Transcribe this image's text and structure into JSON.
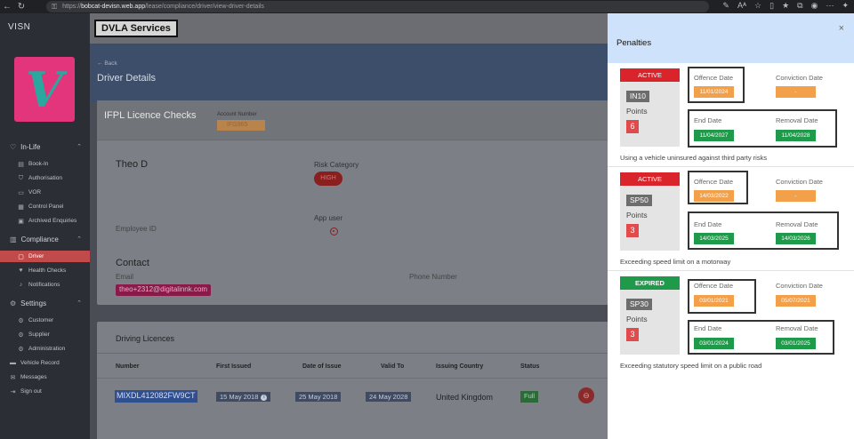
{
  "browser": {
    "url_prefix": "https://",
    "url_host": "bobcat-devisn.web.app",
    "url_path": "/lease/compliance/driver/view-driver-details"
  },
  "sidebar": {
    "brand": "VISN",
    "logo_letter": "V",
    "groups": [
      {
        "label": "In-Life",
        "items": [
          "Book-In",
          "Authorisation",
          "VOR",
          "Control Panel",
          "Archived Enquiries"
        ]
      },
      {
        "label": "Compliance",
        "items": [
          "Driver",
          "Health Checks",
          "Notifications"
        ]
      },
      {
        "label": "Settings",
        "items": [
          "Customer",
          "Supplier",
          "Administration"
        ]
      }
    ],
    "bottom_items": [
      "Vehicle Record",
      "Messages",
      "Sign out"
    ]
  },
  "header": {
    "badge": "DVLA Services"
  },
  "page": {
    "back_label": "Back",
    "title": "Driver Details",
    "ifpl_title": "IFPL Licence Checks",
    "account_label": "Account Number",
    "account_value": "IFG965"
  },
  "driver": {
    "name": "Theo D",
    "risk_label": "Risk Category",
    "risk_value": "HIGH",
    "app_user_label": "App user",
    "employee_id_label": "Employee ID",
    "contact_title": "Contact",
    "email_label": "Email",
    "email_value": "theo+2312@digitalinnk.com",
    "phone_label": "Phone Number"
  },
  "licences": {
    "title": "Driving Licences",
    "columns": [
      "Number",
      "First Issued",
      "Date of Issue",
      "Valid To",
      "Issuing Country",
      "Status"
    ],
    "rows": [
      {
        "number": "MIXDL412082FW9CT",
        "first_issued": "15 May 2018",
        "date_of_issue": "25 May 2018",
        "valid_to": "24 May 2028",
        "country": "United Kingdom",
        "status": "Full"
      }
    ]
  },
  "penalties": {
    "title": "Penalties",
    "labels": {
      "points": "Points",
      "offence": "Offence Date",
      "conviction": "Conviction Date",
      "end": "End Date",
      "removal": "Removal Date"
    },
    "items": [
      {
        "status": "ACTIVE",
        "code": "IN10",
        "points": "6",
        "offence_date": "11/01/2024",
        "conviction_date": "-",
        "end_date": "11/04/2027",
        "removal_date": "11/04/2028",
        "description": "Using a vehicle uninsured against third party risks"
      },
      {
        "status": "ACTIVE",
        "code": "SP50",
        "points": "3",
        "offence_date": "14/03/2022",
        "conviction_date": "-",
        "end_date": "14/03/2025",
        "removal_date": "14/03/2026",
        "description": "Exceeding speed limit on a motorway"
      },
      {
        "status": "EXPIRED",
        "code": "SP30",
        "points": "3",
        "offence_date": "03/01/2021",
        "conviction_date": "05/07/2021",
        "end_date": "03/01/2024",
        "removal_date": "03/01/2025",
        "description": "Exceeding statutory speed limit on a public road"
      }
    ]
  }
}
